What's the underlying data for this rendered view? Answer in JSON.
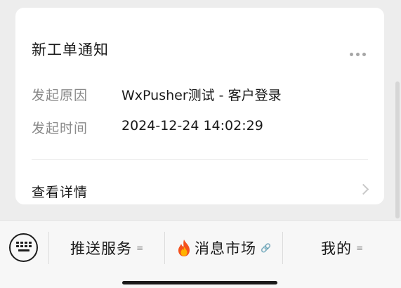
{
  "card": {
    "title": "新工单通知",
    "fields": [
      {
        "label": "发起原因",
        "value": "WxPusher测试 - 客户登录"
      },
      {
        "label": "发起时间",
        "value": "2024-12-24 14:02:29"
      }
    ],
    "detail_label": "查看详情"
  },
  "menu": {
    "items": [
      {
        "label": "推送服务",
        "icon": "list-icon"
      },
      {
        "label": "消息市场",
        "leading_icon": "fire-icon",
        "icon": "link-icon"
      },
      {
        "label": "我的",
        "icon": "list-icon"
      }
    ],
    "keyboard_icon": "keyboard-icon"
  },
  "colors": {
    "background": "#ededed",
    "card": "#ffffff",
    "muted_text": "#8a8a8a",
    "menu_bar": "#f7f7f7"
  }
}
